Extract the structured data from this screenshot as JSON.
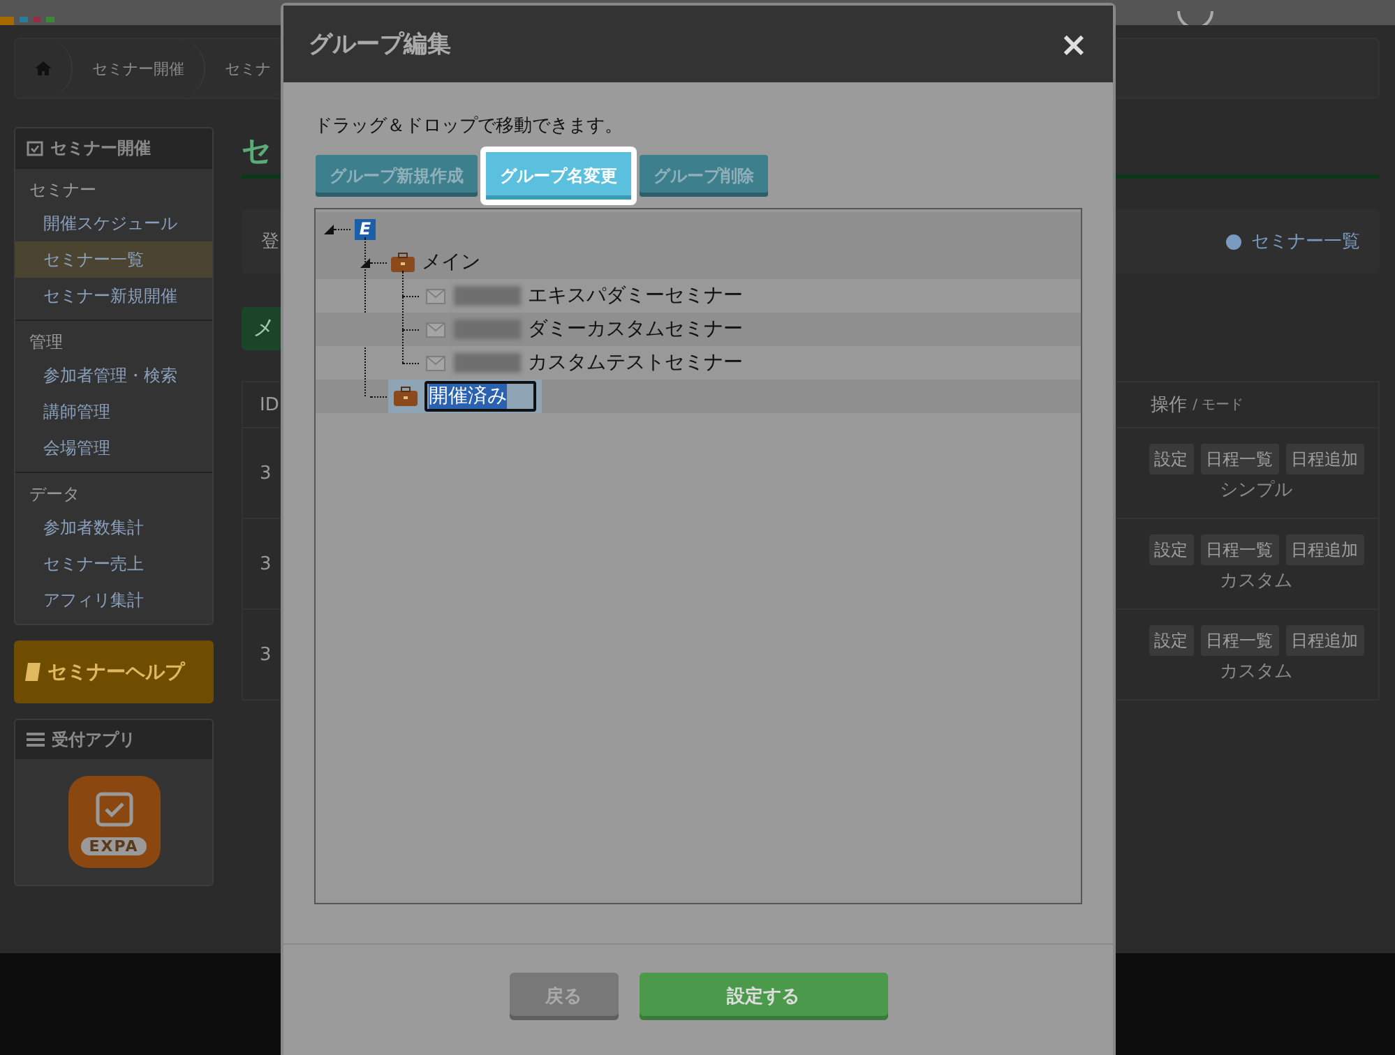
{
  "breadcrumb": [
    "セミナー開催",
    "セミナ"
  ],
  "sidebar": {
    "title": "セミナー開催",
    "sections": [
      {
        "label": "セミナー",
        "items": [
          {
            "label": "開催スケジュール",
            "selected": false
          },
          {
            "label": "セミナー一覧",
            "selected": true
          },
          {
            "label": "セミナー新規開催",
            "selected": false
          }
        ]
      },
      {
        "label": "管理",
        "items": [
          {
            "label": "参加者管理・検索",
            "selected": false
          },
          {
            "label": "講師管理",
            "selected": false
          },
          {
            "label": "会場管理",
            "selected": false
          }
        ]
      },
      {
        "label": "データ",
        "items": [
          {
            "label": "参加者数集計",
            "selected": false
          },
          {
            "label": "セミナー売上",
            "selected": false
          },
          {
            "label": "アフィリ集計",
            "selected": false
          }
        ]
      }
    ],
    "help_button": "セミナーヘルプ",
    "app_panel": {
      "title": "受付アプリ",
      "app_label": "EXPA"
    }
  },
  "main": {
    "title": "セ",
    "card_text": "登",
    "help_link": "セミナー一覧",
    "green_button": "メ",
    "table": {
      "columns": [
        "ID",
        "操作"
      ],
      "mode_hint": "/ モード",
      "rows": [
        {
          "id": "3",
          "actions": [
            "設定",
            "日程一覧",
            "日程追加"
          ],
          "mode": "シンプル"
        },
        {
          "id": "3",
          "actions": [
            "設定",
            "日程一覧",
            "日程追加"
          ],
          "mode": "カスタム"
        },
        {
          "id": "3",
          "actions": [
            "設定",
            "日程一覧",
            "日程追加"
          ],
          "mode": "カスタム"
        }
      ]
    }
  },
  "modal": {
    "title": "グループ編集",
    "close": "×",
    "hint": "ドラッグ＆ドロップで移動できます。",
    "toolbar": [
      {
        "label": "グループ新規作成",
        "selected": false
      },
      {
        "label": "グループ名変更",
        "selected": true
      },
      {
        "label": "グループ削除",
        "selected": false
      }
    ],
    "tree": {
      "label": "E",
      "expanded": true,
      "children": [
        {
          "kind": "group",
          "label": "メイン",
          "expanded": true,
          "editing": false,
          "children": [
            {
              "kind": "seminar",
              "label": "エキスパダミーセミナー"
            },
            {
              "kind": "seminar",
              "label": "ダミーカスタムセミナー"
            },
            {
              "kind": "seminar",
              "label": "カスタムテストセミナー"
            }
          ]
        },
        {
          "kind": "group",
          "label": "開催済み",
          "editing": true
        }
      ]
    },
    "footer": {
      "back": "戻る",
      "submit": "設定する"
    }
  }
}
